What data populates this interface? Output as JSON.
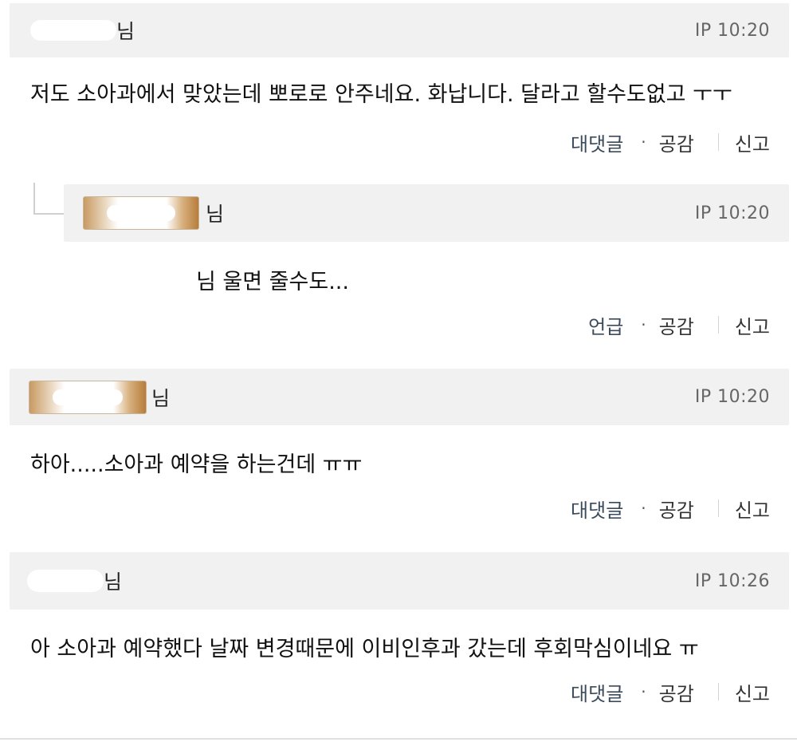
{
  "comments": [
    {
      "author_suffix": "님",
      "meta": "IP 10:20",
      "text": "저도 소아과에서 맞았는데 뽀로로 안주네요. 화납니다. 달라고 할수도없고 ㅜㅜ",
      "actions": {
        "reply": "대댓글",
        "dot": "·",
        "like": "공감",
        "report": "신고"
      }
    },
    {
      "author_suffix": "님",
      "meta": "IP 10:20",
      "text": "님 울면 줄수도...",
      "actions": {
        "reply": "언급",
        "dot": "·",
        "like": "공감",
        "report": "신고"
      }
    },
    {
      "author_suffix": "님",
      "meta": "IP 10:20",
      "text": "하아.....소아과 예약을 하는건데 ㅠㅠ",
      "actions": {
        "reply": "대댓글",
        "dot": "·",
        "like": "공감",
        "report": "신고"
      }
    },
    {
      "author_suffix": "님",
      "meta": "IP 10:26",
      "text": "아 소아과 예약했다 날짜 변경때문에 이비인후과 갔는데 후회막심이네요 ㅠ",
      "actions": {
        "reply": "대댓글",
        "dot": "·",
        "like": "공감",
        "report": "신고"
      }
    }
  ]
}
